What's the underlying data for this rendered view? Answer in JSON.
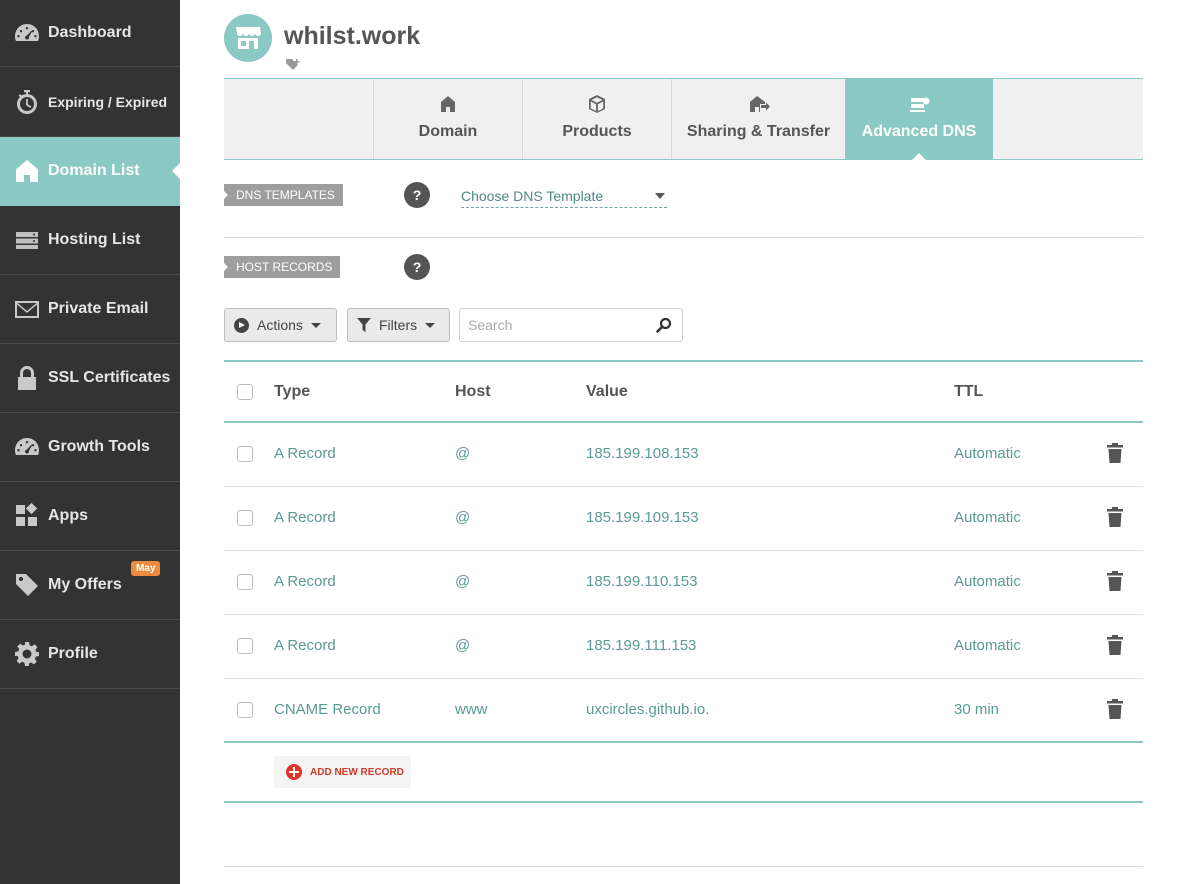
{
  "sidebar": {
    "items": [
      {
        "label": "Dashboard",
        "icon": "gauge-icon",
        "active": false
      },
      {
        "label": "Expiring / Expired",
        "icon": "stopwatch-icon",
        "active": false
      },
      {
        "label": "Domain List",
        "icon": "home-icon",
        "active": true
      },
      {
        "label": "Hosting List",
        "icon": "server-icon",
        "active": false
      },
      {
        "label": "Private Email",
        "icon": "envelope-icon",
        "active": false
      },
      {
        "label": "SSL Certificates",
        "icon": "lock-icon",
        "active": false
      },
      {
        "label": "Growth Tools",
        "icon": "gauge-icon",
        "active": false
      },
      {
        "label": "Apps",
        "icon": "apps-icon",
        "active": false
      },
      {
        "label": "My Offers",
        "icon": "tag-icon",
        "active": false,
        "badge": "May"
      },
      {
        "label": "Profile",
        "icon": "gear-icon",
        "active": false
      }
    ],
    "accent_color": "#8ac9c4"
  },
  "header": {
    "domain_name": "whilst.work"
  },
  "tabs": [
    {
      "label": "Domain",
      "icon": "house-icon"
    },
    {
      "label": "Products",
      "icon": "box-icon"
    },
    {
      "label": "Sharing & Transfer",
      "icon": "share-house-icon"
    },
    {
      "label": "Advanced DNS",
      "icon": "dns-server-icon",
      "active": true
    }
  ],
  "dns_templates": {
    "label": "DNS TEMPLATES",
    "help": "?",
    "select_value": "Choose DNS Template"
  },
  "host_records": {
    "label": "HOST RECORDS",
    "help": "?"
  },
  "toolbar": {
    "actions_label": "Actions",
    "filters_label": "Filters",
    "search_placeholder": "Search"
  },
  "table": {
    "headers": {
      "type": "Type",
      "host": "Host",
      "value": "Value",
      "ttl": "TTL"
    },
    "rows": [
      {
        "type": "A Record",
        "host": "@",
        "value": "185.199.108.153",
        "ttl": "Automatic"
      },
      {
        "type": "A Record",
        "host": "@",
        "value": "185.199.109.153",
        "ttl": "Automatic"
      },
      {
        "type": "A Record",
        "host": "@",
        "value": "185.199.110.153",
        "ttl": "Automatic"
      },
      {
        "type": "A Record",
        "host": "@",
        "value": "185.199.111.153",
        "ttl": "Automatic"
      },
      {
        "type": "CNAME Record",
        "host": "www",
        "value": "uxcircles.github.io.",
        "ttl": "30 min"
      }
    ]
  },
  "add_record_label": "ADD NEW RECORD"
}
